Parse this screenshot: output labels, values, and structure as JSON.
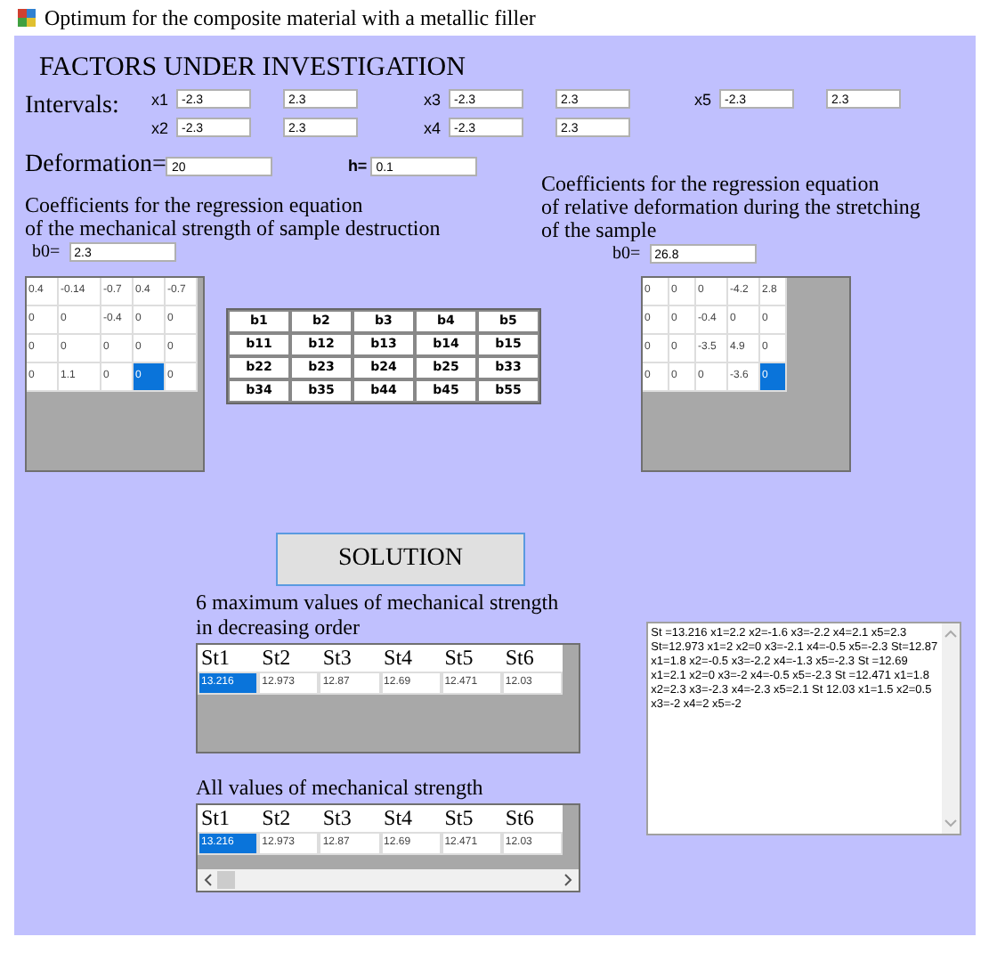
{
  "window": {
    "title": "Optimum for the composite material with a metallic filler"
  },
  "factors": {
    "heading": "FACTORS UNDER INVESTIGATION",
    "intervals_label": "Intervals:",
    "intervals": [
      {
        "label": "x1",
        "low": "-2.3",
        "high": "2.3"
      },
      {
        "label": "x3",
        "low": "-2.3",
        "high": "2.3"
      },
      {
        "label": "x5",
        "low": "-2.3",
        "high": "2.3"
      },
      {
        "label": "x2",
        "low": "-2.3",
        "high": "2.3"
      },
      {
        "label": "x4",
        "low": "-2.3",
        "high": "2.3"
      }
    ],
    "deformation_label": "Deformation=",
    "deformation": "20",
    "h_label": "h=",
    "h": "0.1"
  },
  "strength": {
    "caption_lines": [
      "Coefficients for the regression equation",
      "of the mechanical strength of sample destruction"
    ],
    "b0_label": "b0=",
    "b0": "2.3",
    "matrix": [
      [
        {
          "value": "0.4",
          "selected": false
        },
        {
          "value": "-0.14",
          "selected": false
        },
        {
          "value": "-0.7",
          "selected": false
        },
        {
          "value": "0.4",
          "selected": false
        },
        {
          "value": "-0.7",
          "selected": false
        }
      ],
      [
        {
          "value": "0",
          "selected": false
        },
        {
          "value": "0",
          "selected": false
        },
        {
          "value": "-0.4",
          "selected": false
        },
        {
          "value": "0",
          "selected": false
        },
        {
          "value": "0",
          "selected": false
        }
      ],
      [
        {
          "value": "0",
          "selected": false
        },
        {
          "value": "0",
          "selected": false
        },
        {
          "value": "0",
          "selected": false
        },
        {
          "value": "0",
          "selected": false
        },
        {
          "value": "0",
          "selected": false
        }
      ],
      [
        {
          "value": "0",
          "selected": false
        },
        {
          "value": "1.1",
          "selected": false
        },
        {
          "value": "0",
          "selected": false
        },
        {
          "value": "0",
          "selected": true
        },
        {
          "value": "0",
          "selected": false
        }
      ]
    ]
  },
  "coefficient_labels": [
    [
      "b1",
      "b2",
      "b3",
      "b4",
      "b5"
    ],
    [
      "b11",
      "b12",
      "b13",
      "b14",
      "b15"
    ],
    [
      "b22",
      "b23",
      "b24",
      "b25",
      "b33"
    ],
    [
      "b34",
      "b35",
      "b44",
      "b45",
      "b55"
    ]
  ],
  "deformation_coeffs": {
    "caption_lines": [
      "Coefficients for the regression equation",
      "of relative deformation during the stretching",
      "of the sample"
    ],
    "b0_label": "b0=",
    "b0": "26.8",
    "matrix": [
      [
        {
          "value": "0",
          "selected": false
        },
        {
          "value": "0",
          "selected": false
        },
        {
          "value": "0",
          "selected": false
        },
        {
          "value": "-4.2",
          "selected": false
        },
        {
          "value": "2.8",
          "selected": false
        }
      ],
      [
        {
          "value": "0",
          "selected": false
        },
        {
          "value": "0",
          "selected": false
        },
        {
          "value": "-0.4",
          "selected": false
        },
        {
          "value": "0",
          "selected": false
        },
        {
          "value": "0",
          "selected": false
        }
      ],
      [
        {
          "value": "0",
          "selected": false
        },
        {
          "value": "0",
          "selected": false
        },
        {
          "value": "-3.5",
          "selected": false
        },
        {
          "value": "4.9",
          "selected": false
        },
        {
          "value": "0",
          "selected": false
        }
      ],
      [
        {
          "value": "0",
          "selected": false
        },
        {
          "value": "0",
          "selected": false
        },
        {
          "value": "0",
          "selected": false
        },
        {
          "value": "-3.6",
          "selected": false
        },
        {
          "value": "0",
          "selected": true
        }
      ]
    ]
  },
  "solution_button": "SOLUTION",
  "top_values": {
    "caption": "6 maximum values of mechanical strength in decreasing order",
    "columns": [
      "St1",
      "St2",
      "St3",
      "St4",
      "St5",
      "St6"
    ],
    "row": [
      {
        "value": "13.216",
        "selected": true
      },
      {
        "value": "12.973",
        "selected": false
      },
      {
        "value": "12.87",
        "selected": false
      },
      {
        "value": "12.69",
        "selected": false
      },
      {
        "value": "12.471",
        "selected": false
      },
      {
        "value": "12.03",
        "selected": false
      }
    ]
  },
  "all_values": {
    "caption": "All values of mechanical strength",
    "columns": [
      "St1",
      "St2",
      "St3",
      "St4",
      "St5",
      "St6"
    ],
    "row": [
      {
        "value": "13.216",
        "selected": true
      },
      {
        "value": "12.973",
        "selected": false
      },
      {
        "value": "12.87",
        "selected": false
      },
      {
        "value": "12.69",
        "selected": false
      },
      {
        "value": "12.471",
        "selected": false
      },
      {
        "value": "12.03",
        "selected": false
      }
    ]
  },
  "results_text": "St =13.216 x1=2.2 x2=-1.6 x3=-2.2 x4=2.1 x5=2.3 St=12.973 x1=2 x2=0 x3=-2.1 x4=-0.5 x5=-2.3 St=12.87 x1=1.8 x2=-0.5 x3=-2.2 x4=-1.3 x5=-2.3 St =12.69 x1=2.1 x2=0 x3=-2 x4=-0.5 x5=-2.3 St =12.471 x1=1.8 x2=2.3 x3=-2.3 x4=-2.3 x5=2.1 St 12.03 x1=1.5 x2=0.5 x3=-2 x4=2 x5=-2"
}
